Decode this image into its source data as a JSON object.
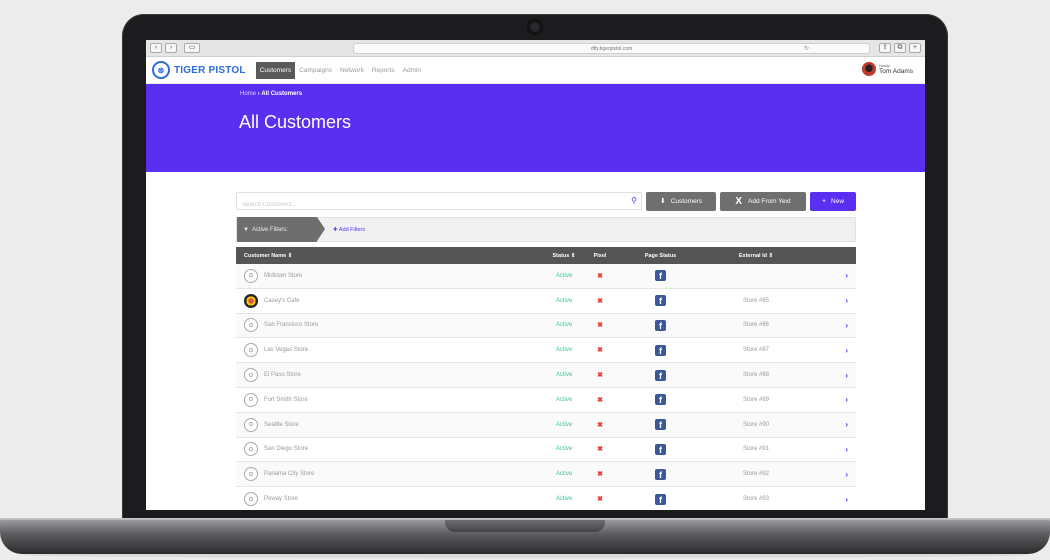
{
  "browser": {
    "url": "dtfy.tigerpistol.com",
    "back": "‹",
    "forward": "›",
    "sidebar": "▭",
    "share": "⇧",
    "tabs": "⧉",
    "plus": "+"
  },
  "app": {
    "logo_text": "TIGER PISTOL",
    "nav": [
      {
        "label": "Customers",
        "active": true
      },
      {
        "label": "Campaigns",
        "active": false
      },
      {
        "label": "Network",
        "active": false
      },
      {
        "label": "Reports",
        "active": false
      },
      {
        "label": "Admin",
        "active": false
      }
    ],
    "user": {
      "small_label": "Howdy",
      "name": "Tom Adams"
    }
  },
  "hero": {
    "breadcrumb_home": "Home",
    "breadcrumb_sep": "›",
    "breadcrumb_current": "All Customers",
    "title": "All Customers"
  },
  "toolbar": {
    "search_placeholder": "Search Customers...",
    "customers_button": "Customers",
    "add_from_yext_button": "Add From Yext",
    "new_button": "New"
  },
  "filters": {
    "active_label": "Active Filters:",
    "add_label": "Add Filters"
  },
  "table": {
    "headers": {
      "name": "Customer Name ⇕",
      "status": "Status ⇕",
      "pixel": "Pixel",
      "page_status": "Page Status",
      "external_id": "External Id ⇕"
    },
    "rows": [
      {
        "name": "Midtown Store",
        "status": "Active",
        "pixel": "✖",
        "page": "f",
        "external_id": "",
        "special_icon": false
      },
      {
        "name": "Casey's Cafe",
        "status": "Active",
        "pixel": "✖",
        "page": "f",
        "external_id": "Store #85",
        "special_icon": true
      },
      {
        "name": "San Fransisco Store",
        "status": "Active",
        "pixel": "✖",
        "page": "f",
        "external_id": "Store #86",
        "special_icon": false
      },
      {
        "name": "Las Vegas Store",
        "status": "Active",
        "pixel": "✖",
        "page": "f",
        "external_id": "Store #87",
        "special_icon": false
      },
      {
        "name": "El Paso Store",
        "status": "Active",
        "pixel": "✖",
        "page": "f",
        "external_id": "Store #88",
        "special_icon": false
      },
      {
        "name": "Fort Smith Store",
        "status": "Active",
        "pixel": "✖",
        "page": "f",
        "external_id": "Store #89",
        "special_icon": false
      },
      {
        "name": "Seattle Store",
        "status": "Active",
        "pixel": "✖",
        "page": "f",
        "external_id": "Store #90",
        "special_icon": false
      },
      {
        "name": "San Diego Store",
        "status": "Active",
        "pixel": "✖",
        "page": "f",
        "external_id": "Store #91",
        "special_icon": false
      },
      {
        "name": "Panama City Store",
        "status": "Active",
        "pixel": "✖",
        "page": "f",
        "external_id": "Store #92",
        "special_icon": false
      },
      {
        "name": "Poway Store",
        "status": "Active",
        "pixel": "✖",
        "page": "f",
        "external_id": "Store #93",
        "special_icon": false
      }
    ]
  },
  "colors": {
    "brand_purple": "#5b2ff2",
    "brand_blue": "#2d6cdf",
    "active_green": "#3ec5a0",
    "pixel_red": "#e53935",
    "facebook_blue": "#3b5998"
  }
}
